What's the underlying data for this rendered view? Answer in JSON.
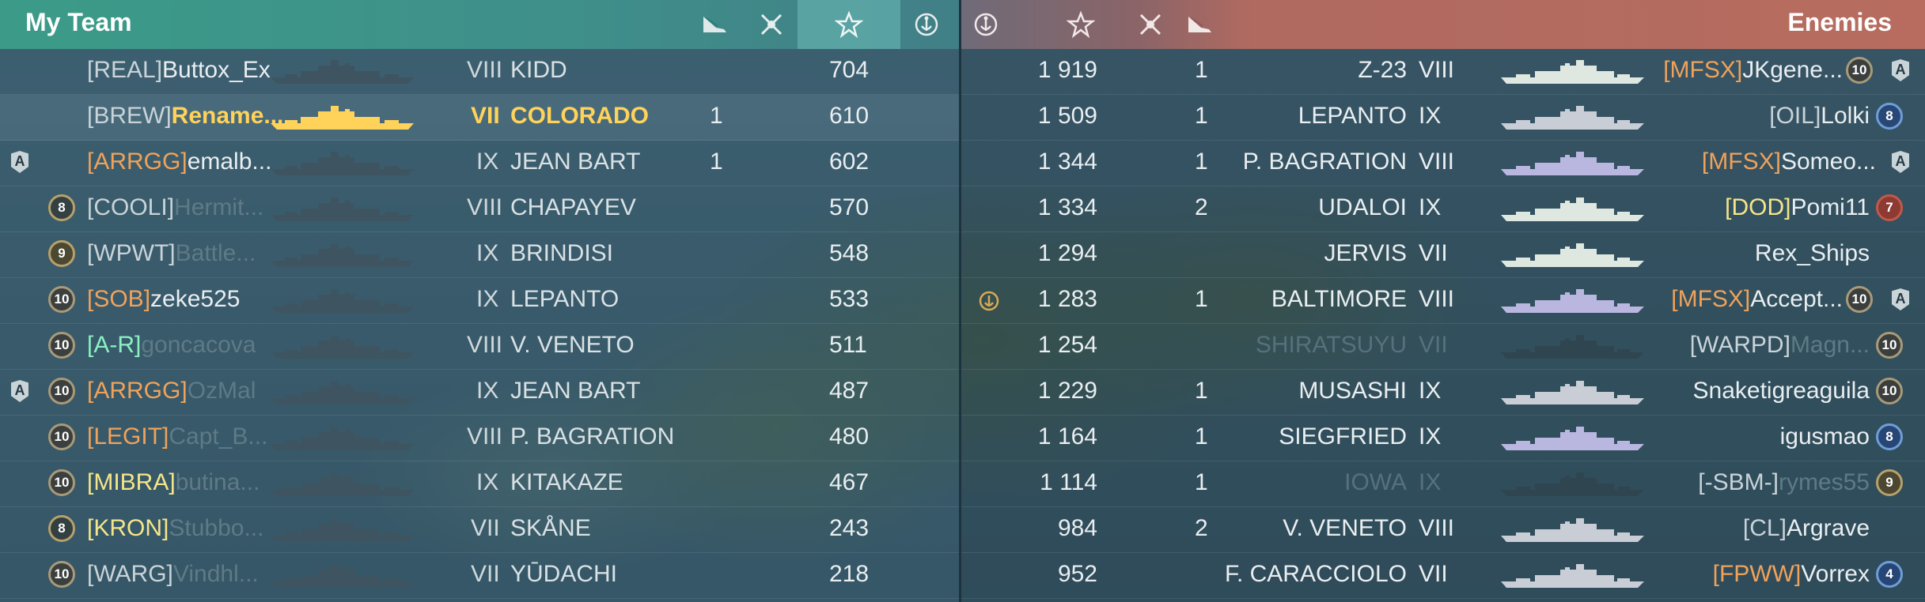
{
  "header": {
    "my_team": "My Team",
    "enemies": "Enemies",
    "icons": [
      "torpedo-icon",
      "planes-shot-icon",
      "star-icon",
      "anchor-icon"
    ]
  },
  "colors": {
    "my_team_header": "#3b9b88",
    "enemies_header": "#b76c5f",
    "player_highlight": "#ffd25a",
    "clan_tag_orange": "#f0a25a"
  },
  "left_rows": [
    {
      "badge": "",
      "level": "",
      "tag": "[REAL]",
      "name": "Buttox_Ex",
      "tier": "VIII",
      "ship": "KIDD",
      "planes": "",
      "score": "704"
    },
    {
      "badge": "",
      "level": "",
      "tag": "[BREW]",
      "name": "Rename...",
      "tier": "VII",
      "ship": "COLORADO",
      "planes": "1",
      "score": "610"
    },
    {
      "badge": "A",
      "level": "",
      "tag": "[ARRGG]",
      "name": "emalb...",
      "tier": "IX",
      "ship": "JEAN BART",
      "planes": "1",
      "score": "602"
    },
    {
      "badge": "",
      "level": "8",
      "tag": "[COOLI]",
      "name": "Hermit...",
      "tier": "VIII",
      "ship": "CHAPAYEV",
      "planes": "",
      "score": "570"
    },
    {
      "badge": "",
      "level": "9",
      "tag": "[WPWT]",
      "name": "Battle...",
      "tier": "IX",
      "ship": "BRINDISI",
      "planes": "",
      "score": "548"
    },
    {
      "badge": "",
      "level": "10",
      "tag": "[SOB]",
      "name": "zeke525",
      "tier": "IX",
      "ship": "LEPANTO",
      "planes": "",
      "score": "533"
    },
    {
      "badge": "",
      "level": "10",
      "tag": "[A-R]",
      "name": "goncacova",
      "tier": "VIII",
      "ship": "V. VENETO",
      "planes": "",
      "score": "511"
    },
    {
      "badge": "A",
      "level": "10",
      "tag": "[ARRGG]",
      "name": "OzMal",
      "tier": "IX",
      "ship": "JEAN BART",
      "planes": "",
      "score": "487"
    },
    {
      "badge": "",
      "level": "10",
      "tag": "[LEGIT]",
      "name": "Capt_B...",
      "tier": "VIII",
      "ship": "P. BAGRATION",
      "planes": "",
      "score": "480"
    },
    {
      "badge": "",
      "level": "10",
      "tag": "[MIBRA]",
      "name": "butina...",
      "tier": "IX",
      "ship": "KITAKAZE",
      "planes": "",
      "score": "467"
    },
    {
      "badge": "",
      "level": "8",
      "tag": "[KRON]",
      "name": "Stubbo...",
      "tier": "VII",
      "ship": "SKÅNE",
      "planes": "",
      "score": "243"
    },
    {
      "badge": "",
      "level": "10",
      "tag": "[WARG]",
      "name": "Vindhl...",
      "tier": "VII",
      "ship": "YŪDACHI",
      "planes": "",
      "score": "218"
    }
  ],
  "right_rows": [
    {
      "anchor": false,
      "score": "1 919",
      "planes": "1",
      "ship": "Z-23",
      "tier": "VIII",
      "tag": "[MFSX]",
      "name": "JKgene...",
      "level": "10",
      "badge": "A"
    },
    {
      "anchor": false,
      "score": "1 509",
      "planes": "1",
      "ship": "LEPANTO",
      "tier": "IX",
      "tag": "[OIL]",
      "name": "Lolki",
      "level": "8",
      "badge": ""
    },
    {
      "anchor": false,
      "score": "1 344",
      "planes": "1",
      "ship": "P. BAGRATION",
      "tier": "VIII",
      "tag": "[MFSX]",
      "name": "Someo...",
      "level": "",
      "badge": "A"
    },
    {
      "anchor": false,
      "score": "1 334",
      "planes": "2",
      "ship": "UDALOI",
      "tier": "IX",
      "tag": "[DOD]",
      "name": "Pomi11",
      "level": "7",
      "badge": ""
    },
    {
      "anchor": false,
      "score": "1 294",
      "planes": "",
      "ship": "JERVIS",
      "tier": "VII",
      "tag": "",
      "name": "Rex_Ships",
      "level": "",
      "badge": ""
    },
    {
      "anchor": true,
      "score": "1 283",
      "planes": "1",
      "ship": "BALTIMORE",
      "tier": "VIII",
      "tag": "[MFSX]",
      "name": "Accept...",
      "level": "10",
      "badge": "A"
    },
    {
      "anchor": false,
      "score": "1 254",
      "planes": "",
      "ship": "SHIRATSUYU",
      "tier": "VII",
      "tag": "[WARPD]",
      "name": "Magn...",
      "level": "10",
      "badge": ""
    },
    {
      "anchor": false,
      "score": "1 229",
      "planes": "1",
      "ship": "MUSASHI",
      "tier": "IX",
      "tag": "",
      "name": "Snaketigreaguila",
      "level": "10",
      "badge": ""
    },
    {
      "anchor": false,
      "score": "1 164",
      "planes": "1",
      "ship": "SIEGFRIED",
      "tier": "IX",
      "tag": "",
      "name": "igusmao",
      "level": "8",
      "badge": ""
    },
    {
      "anchor": false,
      "score": "1 114",
      "planes": "1",
      "ship": "IOWA",
      "tier": "IX",
      "tag": "[-SBM-]",
      "name": "rymes55",
      "level": "9",
      "badge": ""
    },
    {
      "anchor": false,
      "score": "984",
      "planes": "2",
      "ship": "V. VENETO",
      "tier": "VIII",
      "tag": "[CL]",
      "name": "Argrave",
      "level": "",
      "badge": ""
    },
    {
      "anchor": false,
      "score": "952",
      "planes": "",
      "ship": "F. CARACCIOLO",
      "tier": "VII",
      "tag": "[FPWW]",
      "name": "Vorrex",
      "level": "4",
      "badge": ""
    }
  ]
}
